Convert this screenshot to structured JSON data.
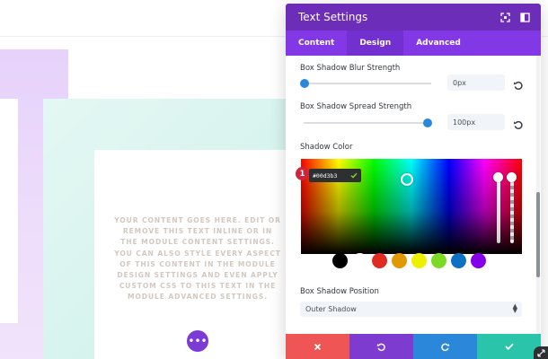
{
  "module": {
    "body_text": "YOUR CONTENT GOES HERE. EDIT OR REMOVE THIS TEXT INLINE OR IN THE MODULE CONTENT SETTINGS. YOU CAN ALSO STYLE EVERY ASPECT OF THIS CONTENT IN THE MODULE DESIGN SETTINGS AND EVEN APPLY CUSTOM CSS TO THIS TEXT IN THE MODULE ADVANCED SETTINGS.",
    "more_icon": "ellipsis-icon"
  },
  "panel": {
    "title": "Text Settings",
    "header_icons": [
      "expand-icon",
      "sidebar-toggle-icon"
    ],
    "tabs": [
      {
        "label": "Content",
        "active": false
      },
      {
        "label": "Design",
        "active": true
      },
      {
        "label": "Advanced",
        "active": false
      }
    ],
    "blur": {
      "label": "Box Shadow Blur Strength",
      "value": "0px",
      "level": 0
    },
    "spread": {
      "label": "Box Shadow Spread Strength",
      "value": "100px",
      "level": 1
    },
    "shadow_color": {
      "label": "Shadow Color",
      "hex": "#00d3b3",
      "badge": "1",
      "swatches": [
        "#000000",
        "#ffffff",
        "#e02b20",
        "#e09900",
        "#edf000",
        "#7cda24",
        "#0c71c3",
        "#8300e9"
      ]
    },
    "position": {
      "label": "Box Shadow Position",
      "value": "Outer Shadow"
    },
    "footer_colors": {
      "cancel": "#ef5555",
      "undo": "#7d3bcf",
      "redo": "#2b87da",
      "save": "#29c4a9"
    }
  },
  "colors": {
    "header": "#6c2eb9",
    "tabs": "#8338e6",
    "accent": "#2b87da"
  }
}
